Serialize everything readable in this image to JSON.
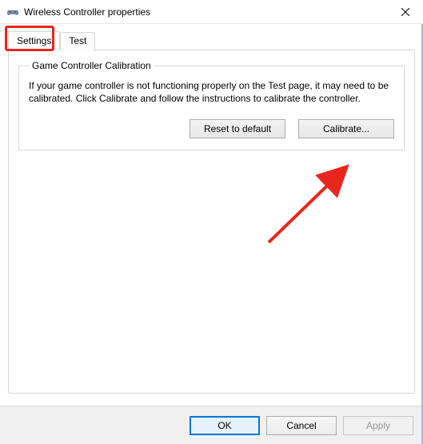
{
  "window": {
    "title": "Wireless Controller properties"
  },
  "tabs": {
    "settings": "Settings",
    "test": "Test"
  },
  "group": {
    "legend": "Game Controller Calibration",
    "description": "If your game controller is not functioning properly on the Test page, it may need to be calibrated.  Click Calibrate and follow the instructions to calibrate the controller.",
    "reset_label": "Reset to default",
    "calibrate_label": "Calibrate..."
  },
  "footer": {
    "ok": "OK",
    "cancel": "Cancel",
    "apply": "Apply"
  }
}
